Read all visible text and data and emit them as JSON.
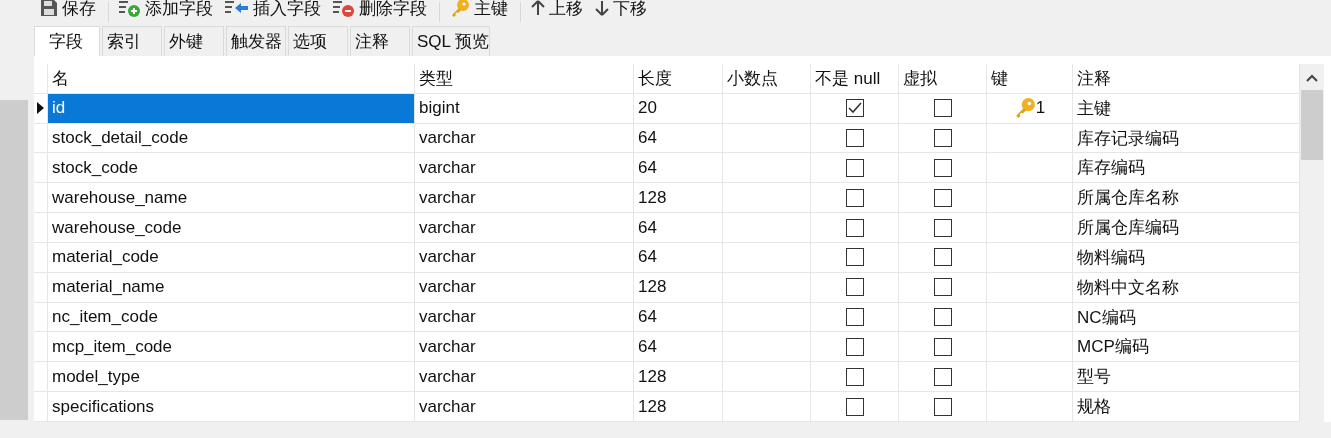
{
  "toolbar": [
    {
      "kind": "save",
      "label": "保存"
    },
    {
      "kind": "add",
      "label": "添加字段"
    },
    {
      "kind": "insert",
      "label": "插入字段"
    },
    {
      "kind": "delete",
      "label": "删除字段"
    },
    {
      "kind": "key",
      "label": "主键"
    },
    {
      "kind": "up",
      "label": "上移"
    },
    {
      "kind": "down",
      "label": "下移"
    }
  ],
  "tabs": [
    {
      "label": "字段",
      "selected": true
    },
    {
      "label": "索引",
      "selected": false
    },
    {
      "label": "外键",
      "selected": false
    },
    {
      "label": "触发器",
      "selected": false
    },
    {
      "label": "选项",
      "selected": false
    },
    {
      "label": "注释",
      "selected": false
    },
    {
      "label": "SQL 预览",
      "selected": false
    }
  ],
  "table": {
    "columns": [
      "名",
      "类型",
      "长度",
      "小数点",
      "不是 null",
      "虚拟",
      "键",
      "注释"
    ],
    "rows": [
      {
        "selected": true,
        "name": "id",
        "type": "bigint",
        "length": "20",
        "not_null": true,
        "virtual": false,
        "key": "1",
        "comment": "主键"
      },
      {
        "selected": false,
        "name": "stock_detail_code",
        "type": "varchar",
        "length": "64",
        "not_null": false,
        "virtual": false,
        "comment": "库存记录编码"
      },
      {
        "selected": false,
        "name": "stock_code",
        "type": "varchar",
        "length": "64",
        "not_null": false,
        "virtual": false,
        "comment": "库存编码"
      },
      {
        "selected": false,
        "name": "warehouse_name",
        "type": "varchar",
        "length": "128",
        "not_null": false,
        "virtual": false,
        "comment": "所属仓库名称"
      },
      {
        "selected": false,
        "name": "warehouse_code",
        "type": "varchar",
        "length": "64",
        "not_null": false,
        "virtual": false,
        "comment": "所属仓库编码"
      },
      {
        "selected": false,
        "name": "material_code",
        "type": "varchar",
        "length": "64",
        "not_null": false,
        "virtual": false,
        "comment": "物料编码"
      },
      {
        "selected": false,
        "name": "material_name",
        "type": "varchar",
        "length": "128",
        "not_null": false,
        "virtual": false,
        "comment": "物料中文名称"
      },
      {
        "selected": false,
        "name": "nc_item_code",
        "type": "varchar",
        "length": "64",
        "not_null": false,
        "virtual": false,
        "comment": "NC编码"
      },
      {
        "selected": false,
        "name": "mcp_item_code",
        "type": "varchar",
        "length": "64",
        "not_null": false,
        "virtual": false,
        "comment": "MCP编码"
      },
      {
        "selected": false,
        "name": "model_type",
        "type": "varchar",
        "length": "128",
        "not_null": false,
        "virtual": false,
        "comment": "型号"
      },
      {
        "selected": false,
        "name": "specifications",
        "type": "varchar",
        "length": "128",
        "not_null": false,
        "virtual": false,
        "comment": "规格"
      }
    ]
  }
}
